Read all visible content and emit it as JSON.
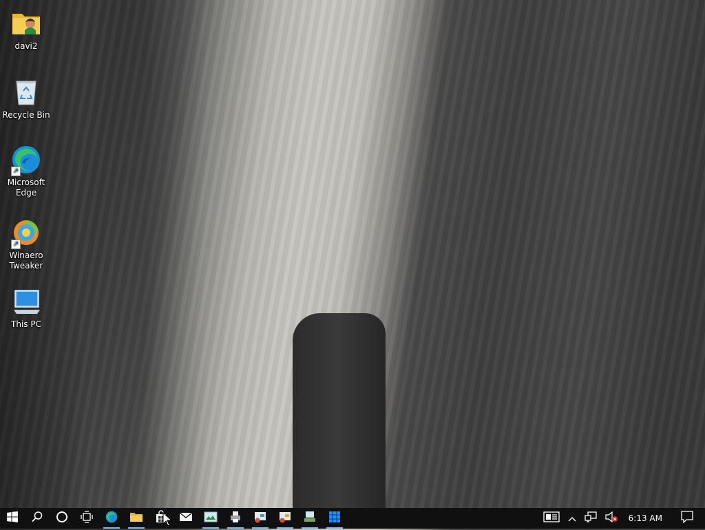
{
  "desktop": {
    "icons": [
      {
        "label": "davi2",
        "icon": "user-folder-icon"
      },
      {
        "label": "Recycle Bin",
        "icon": "recycle-bin-icon"
      },
      {
        "label": "Microsoft Edge",
        "icon": "edge-icon"
      },
      {
        "label": "Winaero Tweaker",
        "icon": "winaero-tweaker-icon"
      },
      {
        "label": "This PC",
        "icon": "this-pc-icon"
      }
    ]
  },
  "taskbar": {
    "buttons": [
      {
        "name": "start-button",
        "icon": "windows-logo-icon"
      },
      {
        "name": "search-button",
        "icon": "search-icon"
      },
      {
        "name": "cortana-button",
        "icon": "cortana-circle-icon"
      },
      {
        "name": "task-view-button",
        "icon": "task-view-icon"
      },
      {
        "name": "edge-taskbar-button",
        "icon": "edge-icon",
        "running": true
      },
      {
        "name": "file-explorer-taskbar-button",
        "icon": "folder-icon",
        "running": true
      },
      {
        "name": "store-taskbar-button",
        "icon": "store-bag-icon"
      },
      {
        "name": "mail-taskbar-button",
        "icon": "mail-icon"
      },
      {
        "name": "app-taskbar-button-1",
        "icon": "picture-viewer-icon",
        "running": true
      },
      {
        "name": "app-taskbar-button-2",
        "icon": "printer-icon",
        "running": true
      },
      {
        "name": "app-taskbar-button-3",
        "icon": "control-panel-icon",
        "running": true
      },
      {
        "name": "app-taskbar-button-4",
        "icon": "control-panel-icon",
        "running": true
      },
      {
        "name": "app-taskbar-button-5",
        "icon": "network-app-icon",
        "running": true
      },
      {
        "name": "app-taskbar-button-6",
        "icon": "grid-app-icon",
        "running": true
      }
    ],
    "tray": {
      "clock": "6:13 AM"
    }
  },
  "colors": {
    "taskbar_bg": "#101010",
    "running_indicator": "#76b9ed"
  }
}
